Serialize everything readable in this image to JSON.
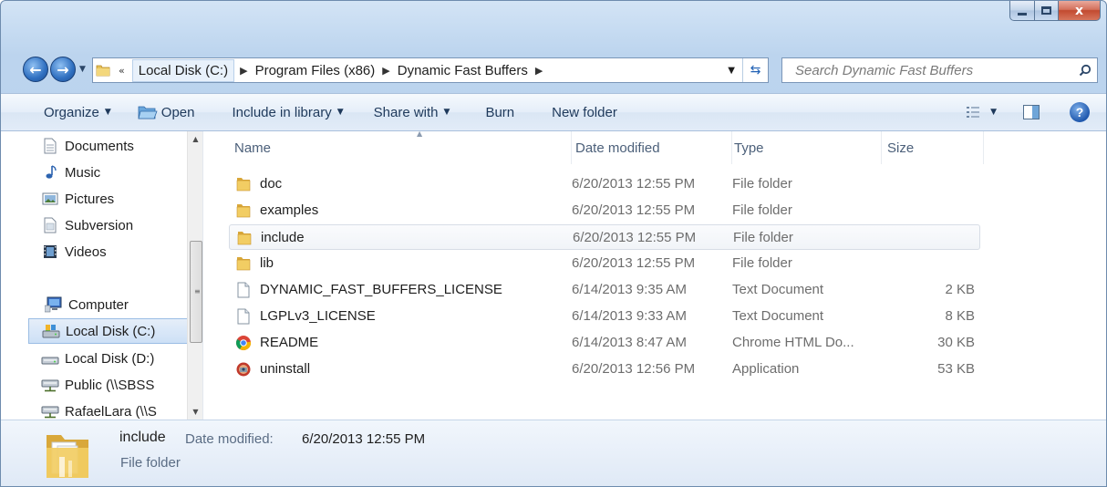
{
  "window": {
    "controls": {
      "minimize": "minimize",
      "maximize": "maximize",
      "close": "x"
    }
  },
  "address": {
    "overflow": "«",
    "crumbs": [
      "Local Disk (C:)",
      "Program Files (x86)",
      "Dynamic Fast Buffers"
    ],
    "search_placeholder": "Search Dynamic Fast Buffers"
  },
  "toolbar": {
    "organize": "Organize",
    "open": "Open",
    "include_in_library": "Include in library",
    "share_with": "Share with",
    "burn": "Burn",
    "new_folder": "New folder"
  },
  "nav": {
    "items": [
      {
        "label": "Documents",
        "icon": "documents-icon"
      },
      {
        "label": "Music",
        "icon": "music-icon"
      },
      {
        "label": "Pictures",
        "icon": "pictures-icon"
      },
      {
        "label": "Subversion",
        "icon": "document-icon"
      },
      {
        "label": "Videos",
        "icon": "videos-icon"
      },
      {
        "label": "Computer",
        "icon": "computer-icon"
      },
      {
        "label": "Local Disk (C:)",
        "icon": "drive-icon",
        "selected": true
      },
      {
        "label": "Local Disk (D:)",
        "icon": "drive-icon"
      },
      {
        "label": "Public (\\\\SBSS",
        "icon": "network-drive-icon"
      },
      {
        "label": "RafaelLara (\\\\S",
        "icon": "network-drive-icon"
      }
    ]
  },
  "columns": {
    "name": "Name",
    "date": "Date modified",
    "type": "Type",
    "size": "Size"
  },
  "files": [
    {
      "name": "doc",
      "date": "6/20/2013 12:55 PM",
      "type": "File folder",
      "size": "",
      "icon": "folder-icon"
    },
    {
      "name": "examples",
      "date": "6/20/2013 12:55 PM",
      "type": "File folder",
      "size": "",
      "icon": "folder-icon"
    },
    {
      "name": "include",
      "date": "6/20/2013 12:55 PM",
      "type": "File folder",
      "size": "",
      "icon": "folder-icon",
      "hover": true
    },
    {
      "name": "lib",
      "date": "6/20/2013 12:55 PM",
      "type": "File folder",
      "size": "",
      "icon": "folder-icon"
    },
    {
      "name": "DYNAMIC_FAST_BUFFERS_LICENSE",
      "date": "6/14/2013 9:35 AM",
      "type": "Text Document",
      "size": "2 KB",
      "icon": "text-document-icon"
    },
    {
      "name": "LGPLv3_LICENSE",
      "date": "6/14/2013 9:33 AM",
      "type": "Text Document",
      "size": "8 KB",
      "icon": "text-document-icon"
    },
    {
      "name": "README",
      "date": "6/14/2013 8:47 AM",
      "type": "Chrome HTML Do...",
      "size": "30 KB",
      "icon": "chrome-icon"
    },
    {
      "name": "uninstall",
      "date": "6/20/2013 12:56 PM",
      "type": "Application",
      "size": "53 KB",
      "icon": "installer-icon"
    }
  ],
  "details": {
    "name": "include",
    "meta_label": "Date modified:",
    "meta_value": "6/20/2013 12:55 PM",
    "type": "File folder"
  },
  "colors": {
    "frame": "#bcd4ee",
    "selection": "#cde0f6",
    "text_muted": "#6d6d6d",
    "close_button": "#c24a30"
  }
}
